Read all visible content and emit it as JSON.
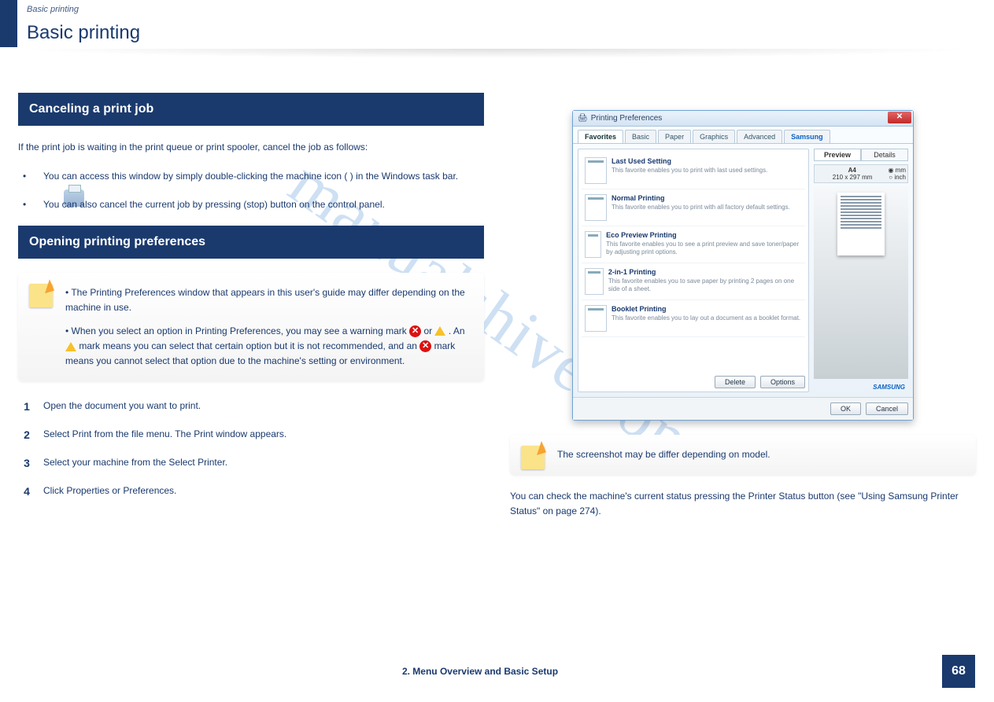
{
  "breadcrumb": "Basic printing",
  "page_title": "Basic printing",
  "section1": {
    "title": "Canceling a print job",
    "intro": "If the print job is waiting in the print queue or print spooler, cancel the job as follows:",
    "steps": [
      "You can access this window by simply double-clicking the machine icon (        ) in the Windows task bar.",
      "You can also cancel the current job by pressing         (stop) button on the control panel."
    ]
  },
  "section2": {
    "title": "Opening printing preferences",
    "note": {
      "p1": "The Printing Preferences window that appears in this user's guide may differ depending on the machine in use.",
      "p2_a": "When you select an option in Printing Preferences, you may see a warning mark ",
      "p2_b": " or ",
      "p2_c": ". An ",
      "p2_d": " mark means you can select that certain option but it is not recommended, and an ",
      "p2_e": " mark means you cannot select that option due to the machine's setting or environment."
    },
    "steps": [
      "Open the document you want to print.",
      "Select Print from the file menu. The Print window appears.",
      "Select your machine from the Select Printer.",
      "Click Properties or Preferences."
    ]
  },
  "dialog": {
    "title": "Printing Preferences",
    "tabs": [
      "Favorites",
      "Basic",
      "Paper",
      "Graphics",
      "Advanced",
      "Samsung"
    ],
    "favorites": [
      {
        "title": "Last Used Setting",
        "desc": "This favorite enables you to print with last used settings."
      },
      {
        "title": "Normal Printing",
        "desc": "This favorite enables you to print with all factory default settings."
      },
      {
        "title": "Eco Preview Printing",
        "desc": "This favorite enables you to see a print preview and save toner/paper by adjusting print options."
      },
      {
        "title": "2-in-1 Printing",
        "desc": "This favorite enables you to save paper by printing 2 pages on one side of a sheet."
      },
      {
        "title": "Booklet Printing",
        "desc": "This favorite enables you to lay out a document as a booklet format."
      }
    ],
    "buttons": {
      "delete": "Delete",
      "options": "Options",
      "ok": "OK",
      "cancel": "Cancel"
    },
    "side": {
      "tabs": [
        "Preview",
        "Details"
      ],
      "paper_size": "A4",
      "paper_dim": "210 x 297 mm",
      "unit_mm": "mm",
      "unit_inch": "inch"
    },
    "brand": "SAMSUNG"
  },
  "right_note": "The screenshot may be differ depending on model.",
  "right_text": "You can check the machine's current status pressing the Printer Status button (see \"Using Samsung Printer Status\" on page 274).",
  "footer": {
    "chapter": "2. Menu Overview and Basic Setup",
    "page": "68"
  },
  "watermark": "manualshive.com"
}
